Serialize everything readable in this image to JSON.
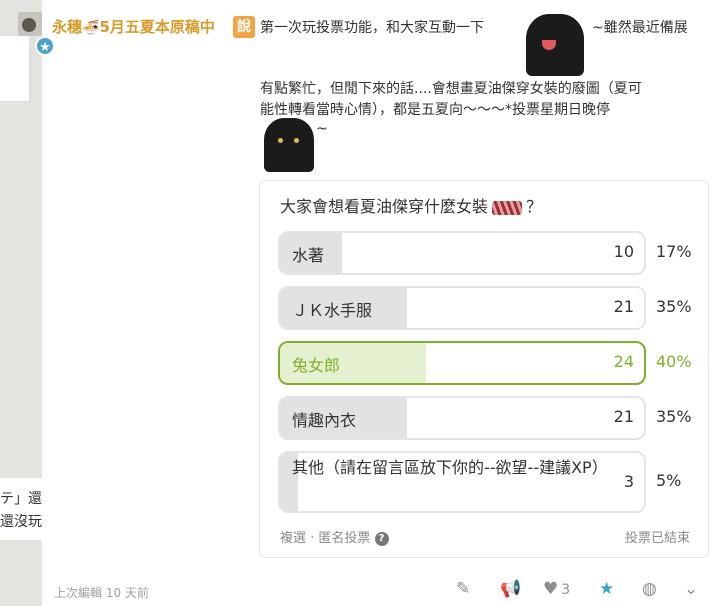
{
  "author": {
    "name": "永穗",
    "badge_text": "5月五夏本原稿中"
  },
  "category_tag": "說",
  "post": {
    "line1": "第一次玩投票功能，和大家互動一下",
    "line1_tail": "~雖然最近備展",
    "line2": "有點繁忙，但閒下來的話....會想畫夏油傑穿女裝的廢圖（夏可",
    "line3": "能性轉看當時心情），都是五夏向～～～*投票星期日晚停",
    "line4": "~"
  },
  "poll": {
    "question": "大家會想看夏油傑穿什麼女裝",
    "question_suffix": "？",
    "options": [
      {
        "label": "水著",
        "count": "10",
        "percent": "17%",
        "fraction": 0.17,
        "selected": false
      },
      {
        "label": "ＪＫ水手服",
        "count": "21",
        "percent": "35%",
        "fraction": 0.35,
        "selected": false
      },
      {
        "label": "兔女郎",
        "count": "24",
        "percent": "40%",
        "fraction": 0.4,
        "selected": true
      },
      {
        "label": "情趣內衣",
        "count": "21",
        "percent": "35%",
        "fraction": 0.35,
        "selected": false
      },
      {
        "label": "其他（請在留言區放下你的--欲望--建議XP）",
        "count": "3",
        "percent": "5%",
        "fraction": 0.05,
        "selected": false
      }
    ],
    "footer_left": "複選 · 匿名投票",
    "footer_right": "投票已結束"
  },
  "left_fragments": {
    "line1": "テ」還",
    "line2": "還沒玩"
  },
  "toolbar": {
    "edited": "上次編輯 10 天前",
    "like_count": "3"
  },
  "colors": {
    "accent_green": "#7fb02a",
    "author_gold": "#d89b2a",
    "tag_orange": "#f0a443",
    "star_blue": "#3aa3c9"
  }
}
